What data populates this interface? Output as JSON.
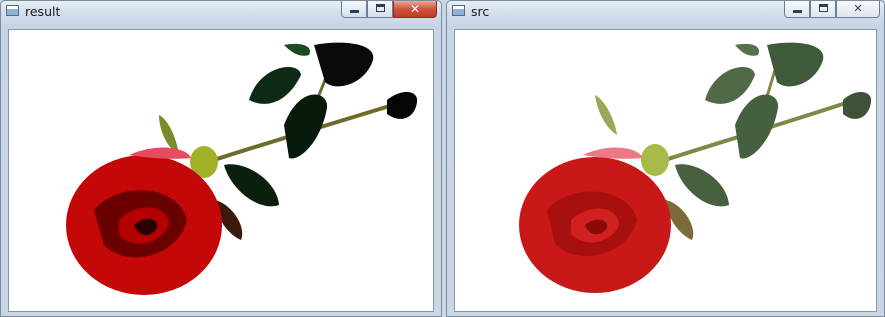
{
  "windows": [
    {
      "title": "result",
      "controls": {
        "minimize": "minimize",
        "maximize": "maximize",
        "close": "close"
      },
      "image": "rose-thresholded"
    },
    {
      "title": "src",
      "controls": {
        "minimize": "minimize",
        "maximize": "maximize",
        "close": "close"
      },
      "image": "rose-original"
    }
  ],
  "colors": {
    "close_red": "#c03a22",
    "frame": "#c9d6e4"
  }
}
